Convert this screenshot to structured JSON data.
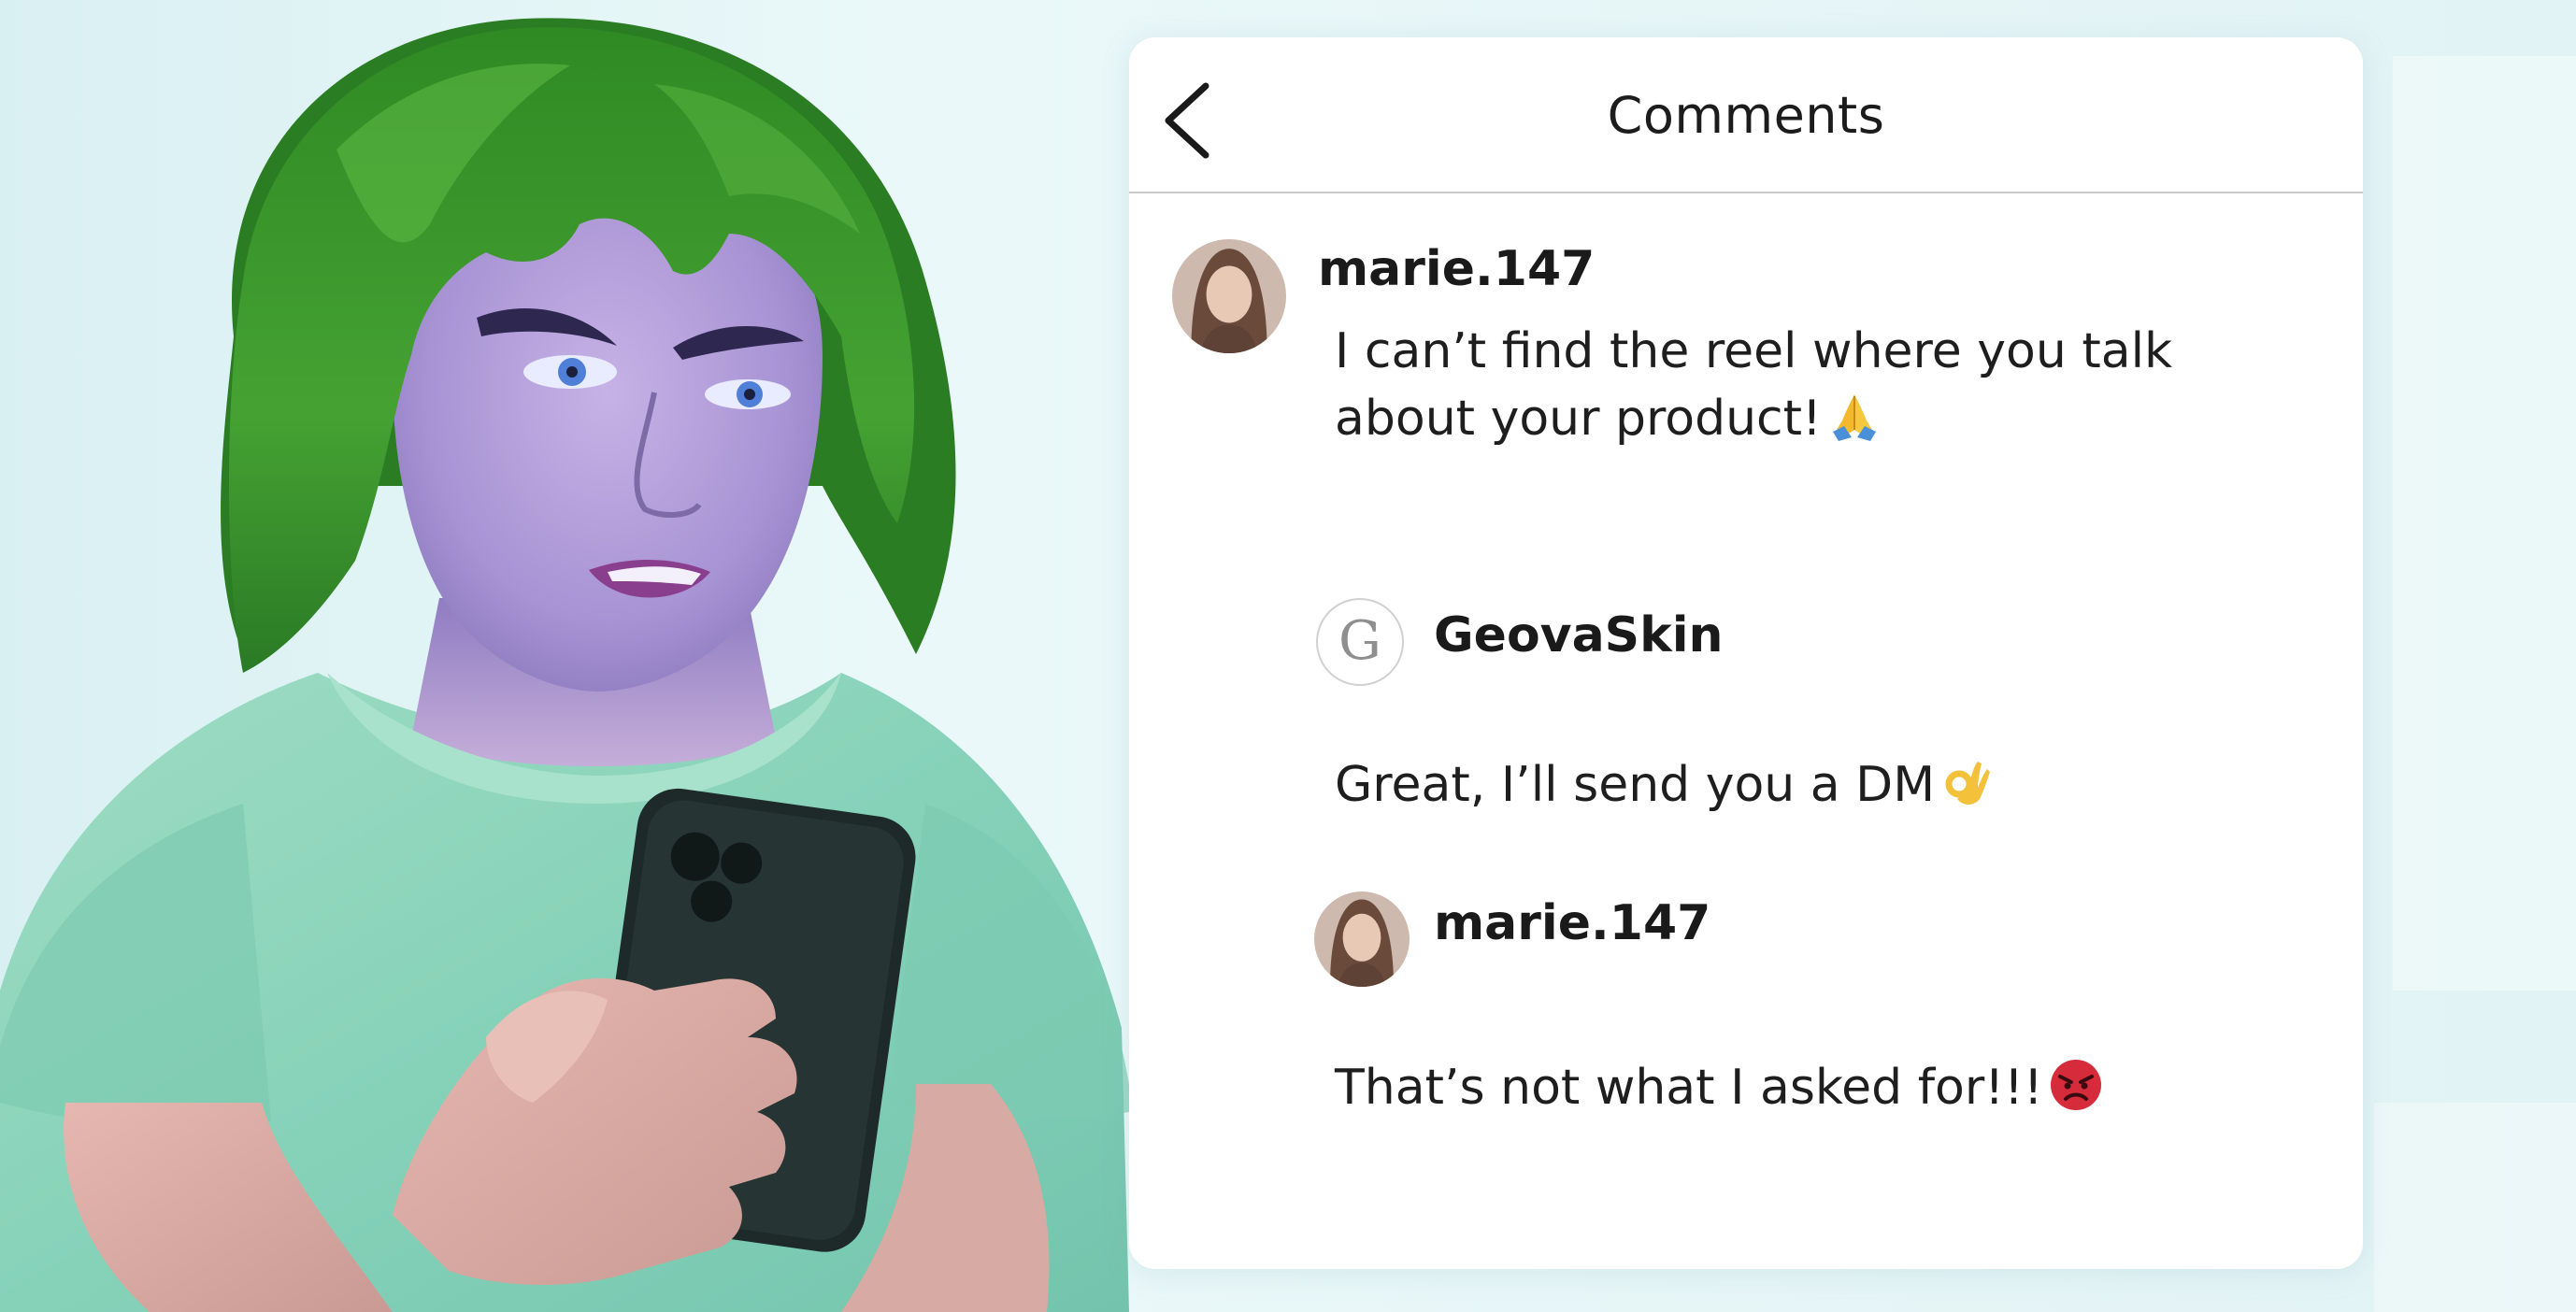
{
  "header": {
    "title": "Comments"
  },
  "comments": [
    {
      "username": "marie.147",
      "line1": "I can’t find the reel where you talk",
      "line2": "about your product!",
      "emoji": "folded-hands-emoji"
    },
    {
      "username": "GeovaSkin",
      "avatar_letter": "G",
      "text": "Great, I’ll send you a DM",
      "emoji": "ok-hand-emoji"
    },
    {
      "username": "marie.147",
      "text": "That’s not what I asked for!!!",
      "emoji": "angry-face-emoji"
    }
  ],
  "colors": {
    "panel": "#ffffff",
    "background": "#e6f6f8",
    "hair": "#3f9a2d",
    "shirt": "#8ed6bd",
    "divider": "#c9c9c9",
    "angry_emoji": "#d62b3a"
  }
}
